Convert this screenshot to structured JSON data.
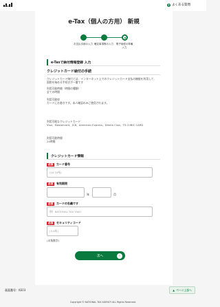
{
  "header": {
    "faq_label": "よくある質問"
  },
  "page": {
    "title": "e-Tax（個人の方用） 新規"
  },
  "stepper": {
    "steps": [
      {
        "label_line1": "お支払手続の入力",
        "label_line2": "",
        "state": "done"
      },
      {
        "label_line1": "確定事項等の入力",
        "label_line2": "",
        "state": "done"
      },
      {
        "label_line1": "電子納税の準備",
        "label_line2": "入力",
        "state": "current"
      }
    ]
  },
  "section": {
    "title": "e-Taxで納付情報登録 入力"
  },
  "credit_info": {
    "heading": "クレジットカード納付の手続",
    "intro_line1": "クレジットカード納付とは、インターネット上でのクレジットカード支払の機能を利用して、",
    "intro_line2": "国税を納める手続きが一番です",
    "fee_title": "利用可能時間（時間の種類）",
    "fee_value": "全ての時間",
    "usage_title": "利用可能枠",
    "usage_value": "カードにお書きです。本人確認のみご使用されます。",
    "brands_title": "利用可能なクレジットカード",
    "brands_value": "Visa、Mastercard、JCB、American Express、Diners Club、TS CUBIC CARD",
    "hours_title": "利用可能時間",
    "hours_value": "24時間"
  },
  "card_form": {
    "section_title": "クレジットカード情報",
    "required_badge": "必須",
    "card_number_label": "カード番号",
    "card_number_placeholder": "(16 10桁)",
    "expiry_label": "有効期限",
    "expiry_month_unit": "年",
    "expiry_year_unit": "月",
    "holder_label": "カードの名義です",
    "holder_placeholder": "例）NATIONAL TAX TAKO",
    "security_label": "セキュリティコード",
    "security_placeholder": "(3-4桁)",
    "security_note": "(半角数字)"
  },
  "actions": {
    "next_label": "次へ",
    "next_arrow": "›",
    "to_top_label": "ページ上部へ",
    "to_top_icon": "▲"
  },
  "footer": {
    "screen_id": "画面番号：KE03",
    "copyright": "Copyright © NATIONAL TAX AGENCY ALL Rights Reserved."
  },
  "colors": {
    "accent": "#0a7a3e",
    "required": "#d9262c"
  }
}
